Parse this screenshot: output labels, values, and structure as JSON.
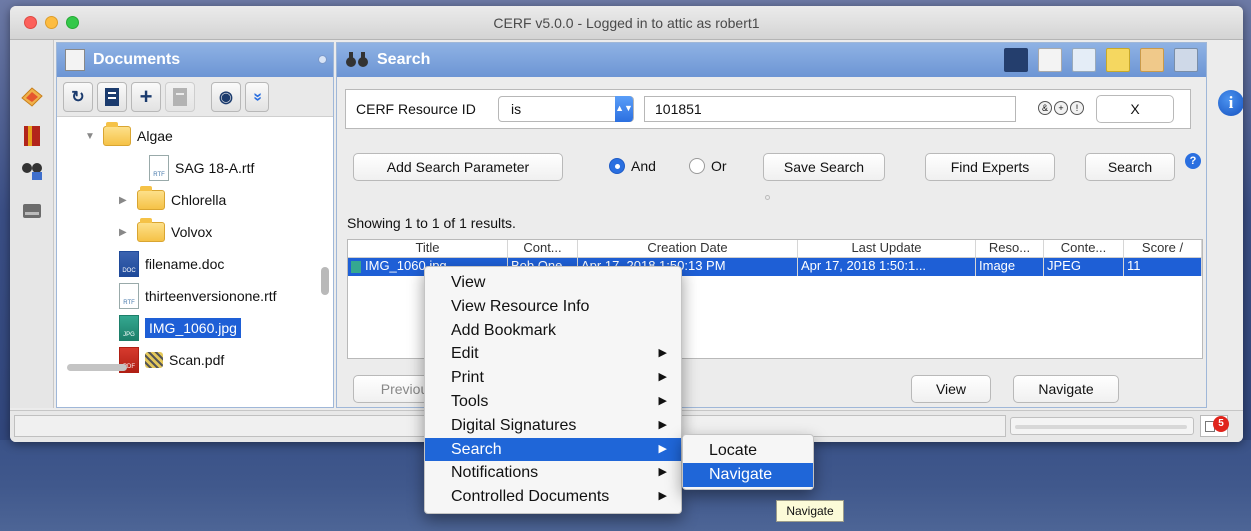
{
  "window": {
    "title": "CERF v5.0.0 - Logged in to attic as robert1"
  },
  "documents": {
    "title": "Documents",
    "tree": [
      {
        "label": "Algae"
      },
      {
        "label": "SAG 18-A.rtf"
      },
      {
        "label": "Chlorella"
      },
      {
        "label": "Volvox"
      },
      {
        "label": "filename.doc"
      },
      {
        "label": "thirteenversionone.rtf"
      },
      {
        "label": "IMG_1060.jpg"
      },
      {
        "label": "Scan.pdf"
      }
    ],
    "file_types": {
      "rtf": "RTF",
      "doc": "DOC",
      "jpg": "JPG",
      "pdf": "PDF"
    }
  },
  "search": {
    "title": "Search",
    "criteria_label": "CERF Resource ID",
    "operator": "is",
    "value": "101851",
    "clear_label": "X",
    "add_param_label": "Add Search Parameter",
    "and_label": "And",
    "or_label": "Or",
    "save_label": "Save Search",
    "find_experts_label": "Find Experts",
    "search_label": "Search",
    "result_summary": "Showing 1 to 1 of 1 results.",
    "columns": [
      "Title",
      "Cont...",
      "Creation Date",
      "Last Update",
      "Reso...",
      "Conte...",
      "Score /"
    ],
    "row": [
      "IMG_1060.jpg",
      "Bob One",
      "Apr 17, 2018 1:50:13 PM",
      "Apr 17, 2018 1:50:1...",
      "Image",
      "JPEG",
      "11"
    ],
    "previous_label": "Previous",
    "view_label": "View",
    "navigate_label": "Navigate"
  },
  "status": {
    "notification_count": "5"
  },
  "context_menu": {
    "items": [
      {
        "label": "View",
        "submenu": false
      },
      {
        "label": "View Resource Info",
        "submenu": false
      },
      {
        "label": "Add Bookmark",
        "submenu": false
      },
      {
        "label": "Edit",
        "submenu": true
      },
      {
        "label": "Print",
        "submenu": true
      },
      {
        "label": "Tools",
        "submenu": true
      },
      {
        "label": "Digital Signatures",
        "submenu": true
      },
      {
        "label": "Search",
        "submenu": true
      },
      {
        "label": "Notifications",
        "submenu": true
      },
      {
        "label": "Controlled Documents",
        "submenu": true
      }
    ],
    "submenu_items": [
      {
        "label": "Locate"
      },
      {
        "label": "Navigate"
      }
    ],
    "highlighted": "Search",
    "submenu_highlighted": "Navigate",
    "submenu_arrow": "▶"
  },
  "tooltip": "Navigate",
  "colors": {
    "selection": "#1e5fd6",
    "panel_header": "#7aa0db",
    "menu_highlight": "#1f66d8"
  },
  "icons": {
    "refresh": "↻",
    "add": "+",
    "eye": "◉",
    "expand": "»",
    "info": "i",
    "help": "?"
  }
}
